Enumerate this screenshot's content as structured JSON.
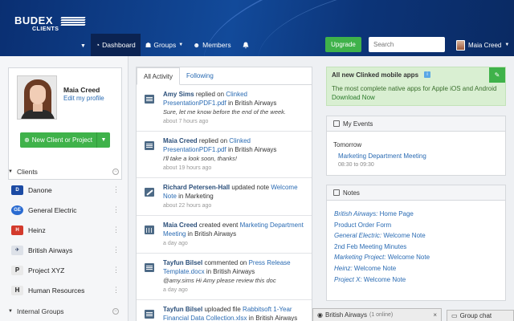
{
  "brand": {
    "name": "BUDEX",
    "sub": "CLIENTS"
  },
  "nav": [
    {
      "label": "Dashboard",
      "icon": "dashboard-icon",
      "active": true
    },
    {
      "label": "Groups",
      "icon": "groups-icon",
      "dropdown": true
    },
    {
      "label": "Members",
      "icon": "members-icon"
    }
  ],
  "header": {
    "upgrade_label": "Upgrade",
    "search_placeholder": "Search",
    "user_name": "Maia Creed"
  },
  "profile": {
    "name": "Maia Creed",
    "edit_label": "Edit my profile"
  },
  "new_client_label": "New Client or Project",
  "clients_section": {
    "label": "Clients"
  },
  "clients": [
    {
      "name": "Danone",
      "logo_color": "#1b4aa3"
    },
    {
      "name": "General Electric",
      "logo_color": "#2a6bd1"
    },
    {
      "name": "Heinz",
      "logo_color": "#d33a2c"
    },
    {
      "name": "British Airways",
      "logo_color": "#9aa5b8"
    },
    {
      "name": "Project XYZ",
      "logo_text": "P",
      "logo_color": "#333333"
    },
    {
      "name": "Human Resources",
      "logo_text": "H",
      "logo_color": "#333333"
    }
  ],
  "internal_groups_section": {
    "label": "Internal Groups"
  },
  "feed": {
    "tabs": [
      "All Activity",
      "Following"
    ],
    "items": [
      {
        "who": "Amy Sims",
        "action": "replied on",
        "target": "Clinked PresentationPDF1.pdf",
        "context_pre": "in",
        "context": "British Airways",
        "quote": "Sure, let me know before the end of the week.",
        "when": "about 7 hours ago",
        "icon": "note"
      },
      {
        "who": "Maia Creed",
        "action": "replied on",
        "target": "Clinked PresentationPDF1.pdf",
        "context_pre": "in",
        "context": "British Airways",
        "quote": "I'll take a look soon, thanks!",
        "when": "about 19 hours ago",
        "icon": "note"
      },
      {
        "who": "Richard Petersen-Hall",
        "action": "updated note",
        "target": "Welcome Note",
        "context_pre": "in",
        "context": "Marketing",
        "quote": "",
        "when": "about 22 hours ago",
        "icon": "edit"
      },
      {
        "who": "Maia Creed",
        "action": "created event",
        "target": "Marketing Department Meeting",
        "context_pre": "in",
        "context": "British Airways",
        "quote": "",
        "when": "a day ago",
        "icon": "cal"
      },
      {
        "who": "Tayfun Bilsel",
        "action": "commented on",
        "target": "Press Release Template.docx",
        "context_pre": "in",
        "context": "British Airways",
        "quote": "@amy.sims Hi Amy please review this doc",
        "when": "a day ago",
        "icon": "note"
      },
      {
        "who": "Tayfun Bilsel",
        "action": "uploaded file",
        "target": "Rabbitsoft 1-Year Financial Data Collection.xlsx",
        "context_pre": "in",
        "context": "British Airways",
        "quote": "",
        "when": "",
        "icon": "note"
      }
    ]
  },
  "promo": {
    "title": "All new Clinked mobile apps",
    "badge": "i",
    "desc": "The most complete native apps for Apple iOS and Android",
    "link": "Download Now"
  },
  "events": {
    "title": "My Events",
    "day": "Tomorrow",
    "event_name": "Marketing Department Meeting",
    "event_time": "08:30 to 09:30"
  },
  "notes": {
    "title": "Notes",
    "items": [
      {
        "context": "British Airways:",
        "name": "Home Page"
      },
      {
        "context": "",
        "name": "Product Order Form"
      },
      {
        "context": "General Electric:",
        "name": "Welcome Note"
      },
      {
        "context": "",
        "name": "2nd Feb Meeting Minutes"
      },
      {
        "context": "Marketing Project:",
        "name": "Welcome Note"
      },
      {
        "context": "Heinz:",
        "name": "Welcome Note"
      },
      {
        "context": "Project X:",
        "name": "Welcome Note"
      }
    ]
  },
  "chat": {
    "room": "British Airways",
    "status": "(1 online)",
    "close": "×",
    "group_chat_label": "Group chat"
  }
}
